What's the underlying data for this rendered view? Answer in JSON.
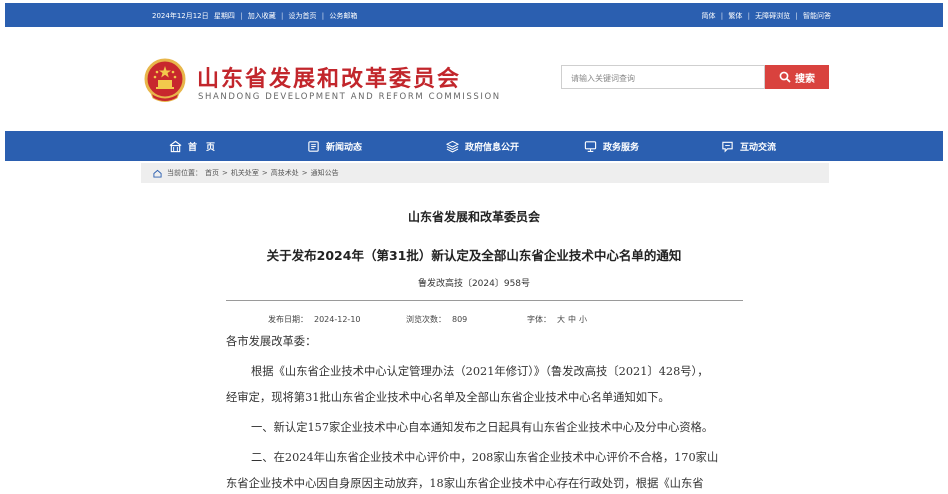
{
  "topbar": {
    "date": "2024年12月12日",
    "weekday": "星期四",
    "links_left": [
      "加入收藏",
      "设为首页",
      "公务邮箱"
    ],
    "links_right": [
      "简体",
      "繁体",
      "无障碍浏览",
      "智能问答"
    ]
  },
  "header": {
    "title": "山东省发展和改革委员会",
    "subtitle": "SHANDONG DEVELOPMENT AND REFORM COMMISSION",
    "search_placeholder": "请输入关键词查询",
    "search_button": "搜索"
  },
  "nav": {
    "items": [
      {
        "label": "首　页",
        "icon": "home-icon"
      },
      {
        "label": "新闻动态",
        "icon": "news-icon"
      },
      {
        "label": "政府信息公开",
        "icon": "layers-icon"
      },
      {
        "label": "政务服务",
        "icon": "monitor-icon"
      },
      {
        "label": "互动交流",
        "icon": "chat-icon"
      }
    ]
  },
  "breadcrumb": {
    "prefix": "当前位置：",
    "path": [
      "首页",
      "机关处室",
      "高技术处",
      "通知公告"
    ]
  },
  "article": {
    "org": "山东省发展和改革委员会",
    "title": "关于发布2024年（第31批）新认定及全部山东省企业技术中心名单的通知",
    "doc_number": "鲁发改高技〔2024〕958号",
    "publish_label": "发布日期：",
    "publish_date": "2024-12-10",
    "views_label": "浏览次数：",
    "views": "809",
    "font_label": "字体：",
    "font_sizes": [
      "大",
      "中",
      "小"
    ],
    "paragraphs": [
      "各市发展改革委：",
      "根据《山东省企业技术中心认定管理办法（2021年修订）》（鲁发改高技〔2021〕428号），",
      "经审定，现将第31批山东省企业技术中心名单及全部山东省企业技术中心名单通知如下。",
      "一、新认定157家企业技术中心自本通知发布之日起具有山东省企业技术中心及分中心资格。",
      "二、在2024年山东省企业技术中心评价中，208家山东省企业技术中心评价不合格，170家山",
      "东省企业技术中心因自身原因主动放弃，18家山东省企业技术中心存在行政处罚，根据《山东省"
    ]
  },
  "colors": {
    "brand_blue": "#2b5fb0",
    "title_red": "#c2262c",
    "search_red": "#d9423e"
  }
}
